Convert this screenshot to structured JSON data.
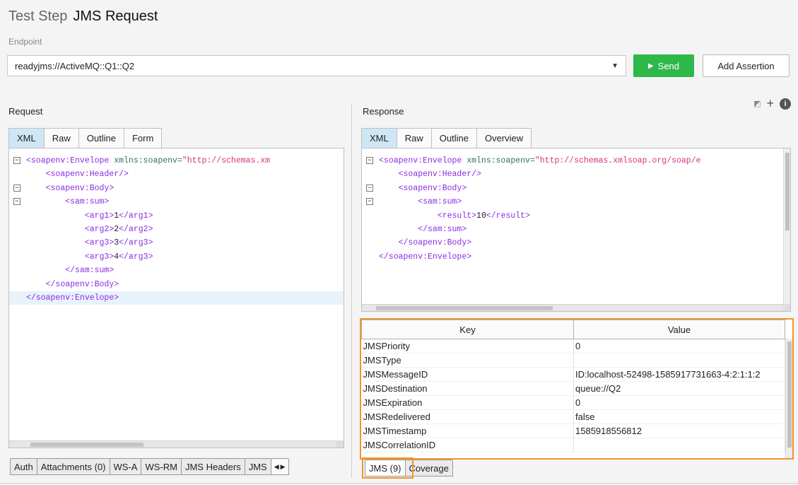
{
  "header": {
    "prefix": "Test Step",
    "name": "JMS Request"
  },
  "endpoint": {
    "label": "Endpoint",
    "value": "readyjms://ActiveMQ::Q1::Q2"
  },
  "buttons": {
    "send": "Send",
    "add_assertion": "Add Assertion"
  },
  "request": {
    "label": "Request",
    "tabs": [
      "XML",
      "Raw",
      "Outline",
      "Form"
    ],
    "bottom_tabs": [
      "Auth",
      "Attachments (0)",
      "WS-A",
      "WS-RM",
      "JMS Headers",
      "JMS"
    ],
    "lines": {
      "l1": {
        "open": "<soapenv:Envelope",
        "attr": " xmlns:soapenv=",
        "str": "\"http://schemas.xm"
      },
      "l2": "<soapenv:Header/>",
      "l3": "<soapenv:Body>",
      "l4": "<sam:sum>",
      "l5": {
        "o": "<arg1>",
        "v": "1",
        "c": "</arg1>"
      },
      "l6": {
        "o": "<arg2>",
        "v": "2",
        "c": "</arg2>"
      },
      "l7": {
        "o": "<arg3>",
        "v": "3",
        "c": "</arg3>"
      },
      "l8": {
        "o": "<arg3>",
        "v": "4",
        "c": "</arg3>"
      },
      "l9": "</sam:sum>",
      "l10": "</soapenv:Body>",
      "l11": "</soapenv:Envelope>"
    }
  },
  "response": {
    "label": "Response",
    "tabs": [
      "XML",
      "Raw",
      "Outline",
      "Overview"
    ],
    "bottom_tabs": [
      "JMS (9)",
      "Coverage"
    ],
    "lines": {
      "l1": {
        "open": "<soapenv:Envelope",
        "attr": " xmlns:soapenv=",
        "str": "\"http://schemas.xmlsoap.org/soap/e"
      },
      "l2": "<soapenv:Header/>",
      "l3": "<soapenv:Body>",
      "l4": "<sam:sum>",
      "l5": {
        "o": "<result>",
        "v": "10",
        "c": "</result>"
      },
      "l6": "</sam:sum>",
      "l7": "</soapenv:Body>",
      "l8": "</soapenv:Envelope>"
    },
    "table": {
      "headers": {
        "key": "Key",
        "value": "Value"
      },
      "rows": [
        {
          "key": "JMSPriority",
          "value": "0"
        },
        {
          "key": "JMSType",
          "value": ""
        },
        {
          "key": "JMSMessageID",
          "value": "ID:localhost-52498-1585917731663-4:2:1:1:2"
        },
        {
          "key": "JMSDestination",
          "value": "queue://Q2"
        },
        {
          "key": "JMSExpiration",
          "value": "0"
        },
        {
          "key": "JMSRedelivered",
          "value": "false"
        },
        {
          "key": "JMSTimestamp",
          "value": "1585918556812"
        },
        {
          "key": "JMSCorrelationID",
          "value": ""
        }
      ]
    }
  },
  "icons": {
    "play": "play-icon",
    "dropdown": "chevron-down-icon",
    "collapse": "minus-box-icon",
    "info": "info-icon",
    "add": "plus-icon",
    "layout": "layout-icon"
  }
}
